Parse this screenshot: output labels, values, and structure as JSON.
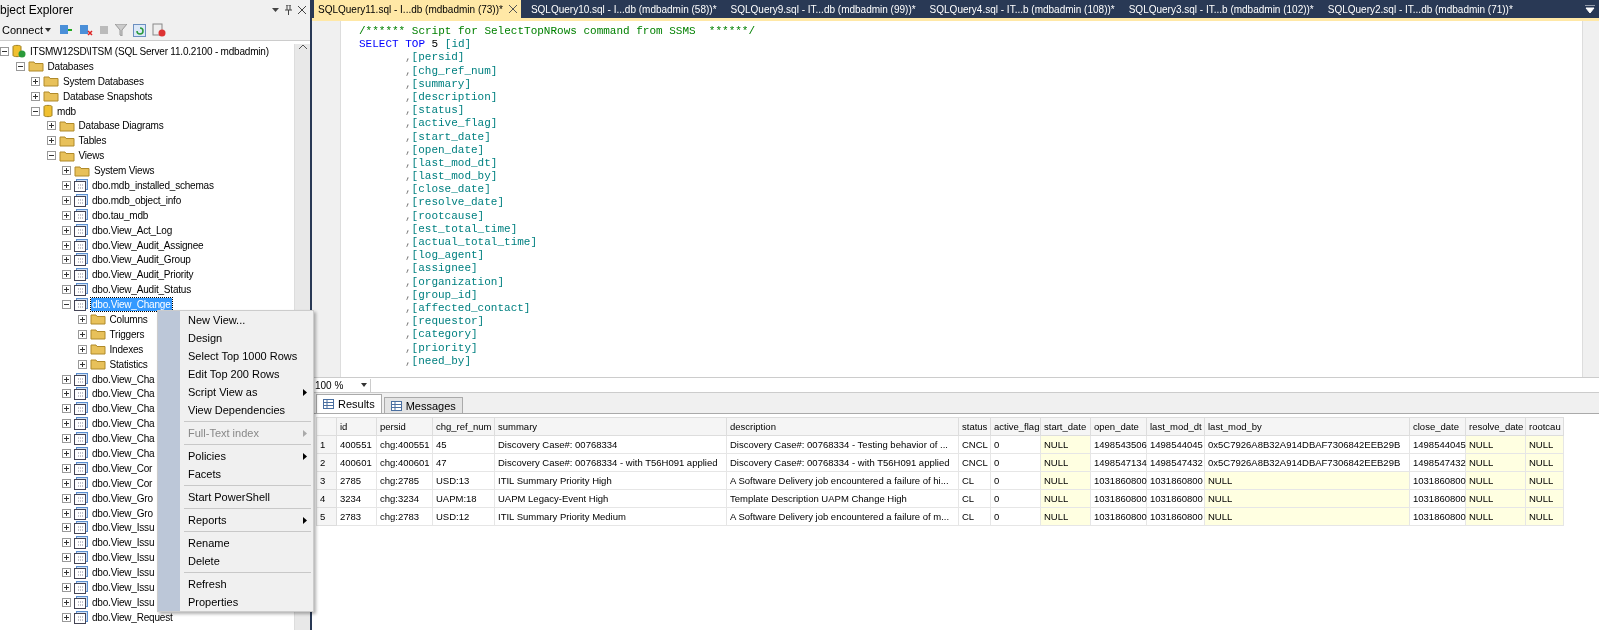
{
  "explorer": {
    "title": "bject Explorer",
    "connect": "Connect",
    "tree": [
      {
        "label": "ITSMW12SD\\ITSM (SQL Server 11.0.2100 - mdbadmin)",
        "kind": "server",
        "expanded": true,
        "selected": false,
        "children": [
          {
            "label": "Databases",
            "kind": "folder",
            "expanded": true,
            "selected": false,
            "children": [
              {
                "label": "System Databases",
                "kind": "folder",
                "expanded": false,
                "selected": false
              },
              {
                "label": "Database Snapshots",
                "kind": "folder",
                "expanded": false,
                "selected": false
              },
              {
                "label": "mdb",
                "kind": "database",
                "expanded": true,
                "selected": false,
                "children": [
                  {
                    "label": "Database Diagrams",
                    "kind": "folder",
                    "expanded": false,
                    "selected": false
                  },
                  {
                    "label": "Tables",
                    "kind": "folder",
                    "expanded": false,
                    "selected": false
                  },
                  {
                    "label": "Views",
                    "kind": "folder",
                    "expanded": true,
                    "selected": false,
                    "children": [
                      {
                        "label": "System Views",
                        "kind": "folder",
                        "expanded": false,
                        "selected": false
                      },
                      {
                        "label": "dbo.mdb_installed_schemas",
                        "kind": "view",
                        "expanded": false,
                        "selected": false
                      },
                      {
                        "label": "dbo.mdb_object_info",
                        "kind": "view",
                        "expanded": false,
                        "selected": false
                      },
                      {
                        "label": "dbo.tau_mdb",
                        "kind": "view",
                        "expanded": false,
                        "selected": false
                      },
                      {
                        "label": "dbo.View_Act_Log",
                        "kind": "view",
                        "expanded": false,
                        "selected": false
                      },
                      {
                        "label": "dbo.View_Audit_Assignee",
                        "kind": "view",
                        "expanded": false,
                        "selected": false
                      },
                      {
                        "label": "dbo.View_Audit_Group",
                        "kind": "view",
                        "expanded": false,
                        "selected": false
                      },
                      {
                        "label": "dbo.View_Audit_Priority",
                        "kind": "view",
                        "expanded": false,
                        "selected": false
                      },
                      {
                        "label": "dbo.View_Audit_Status",
                        "kind": "view",
                        "expanded": false,
                        "selected": false
                      },
                      {
                        "label": "dbo.View_Change",
                        "kind": "view",
                        "expanded": true,
                        "selected": true,
                        "children": [
                          {
                            "label": "Columns",
                            "kind": "folder",
                            "expanded": false,
                            "selected": false
                          },
                          {
                            "label": "Triggers",
                            "kind": "folder",
                            "expanded": false,
                            "selected": false
                          },
                          {
                            "label": "Indexes",
                            "kind": "folder",
                            "expanded": false,
                            "selected": false
                          },
                          {
                            "label": "Statistics",
                            "kind": "folder",
                            "expanded": false,
                            "selected": false
                          }
                        ]
                      },
                      {
                        "label": "dbo.View_Cha",
                        "kind": "view",
                        "expanded": false,
                        "selected": false
                      },
                      {
                        "label": "dbo.View_Cha",
                        "kind": "view",
                        "expanded": false,
                        "selected": false
                      },
                      {
                        "label": "dbo.View_Cha",
                        "kind": "view",
                        "expanded": false,
                        "selected": false
                      },
                      {
                        "label": "dbo.View_Cha",
                        "kind": "view",
                        "expanded": false,
                        "selected": false
                      },
                      {
                        "label": "dbo.View_Cha",
                        "kind": "view",
                        "expanded": false,
                        "selected": false
                      },
                      {
                        "label": "dbo.View_Cha",
                        "kind": "view",
                        "expanded": false,
                        "selected": false
                      },
                      {
                        "label": "dbo.View_Cor",
                        "kind": "view",
                        "expanded": false,
                        "selected": false
                      },
                      {
                        "label": "dbo.View_Cor",
                        "kind": "view",
                        "expanded": false,
                        "selected": false
                      },
                      {
                        "label": "dbo.View_Gro",
                        "kind": "view",
                        "expanded": false,
                        "selected": false
                      },
                      {
                        "label": "dbo.View_Gro",
                        "kind": "view",
                        "expanded": false,
                        "selected": false
                      },
                      {
                        "label": "dbo.View_Issu",
                        "kind": "view",
                        "expanded": false,
                        "selected": false
                      },
                      {
                        "label": "dbo.View_Issu",
                        "kind": "view",
                        "expanded": false,
                        "selected": false
                      },
                      {
                        "label": "dbo.View_Issu",
                        "kind": "view",
                        "expanded": false,
                        "selected": false
                      },
                      {
                        "label": "dbo.View_Issu",
                        "kind": "view",
                        "expanded": false,
                        "selected": false
                      },
                      {
                        "label": "dbo.View_Issu",
                        "kind": "view",
                        "expanded": false,
                        "selected": false
                      },
                      {
                        "label": "dbo.View_Issu",
                        "kind": "view",
                        "expanded": false,
                        "selected": false
                      },
                      {
                        "label": "dbo.View_Request",
                        "kind": "view",
                        "expanded": false,
                        "selected": false
                      }
                    ]
                  }
                ]
              }
            ]
          }
        ]
      }
    ]
  },
  "context_menu": [
    {
      "label": "New View...",
      "separator_before": false,
      "disabled": false,
      "submenu": false
    },
    {
      "label": "Design",
      "separator_before": false,
      "disabled": false,
      "submenu": false
    },
    {
      "label": "Select Top 1000 Rows",
      "separator_before": false,
      "disabled": false,
      "submenu": false
    },
    {
      "label": "Edit Top 200 Rows",
      "separator_before": false,
      "disabled": false,
      "submenu": false
    },
    {
      "label": "Script View as",
      "separator_before": false,
      "disabled": false,
      "submenu": true
    },
    {
      "label": "View Dependencies",
      "separator_before": false,
      "disabled": false,
      "submenu": false
    },
    {
      "label": "Full-Text index",
      "separator_before": true,
      "disabled": true,
      "submenu": true
    },
    {
      "label": "Policies",
      "separator_before": true,
      "disabled": false,
      "submenu": true
    },
    {
      "label": "Facets",
      "separator_before": false,
      "disabled": false,
      "submenu": false
    },
    {
      "label": "Start PowerShell",
      "separator_before": true,
      "disabled": false,
      "submenu": false
    },
    {
      "label": "Reports",
      "separator_before": true,
      "disabled": false,
      "submenu": true
    },
    {
      "label": "Rename",
      "separator_before": true,
      "disabled": false,
      "submenu": false
    },
    {
      "label": "Delete",
      "separator_before": false,
      "disabled": false,
      "submenu": false
    },
    {
      "label": "Refresh",
      "separator_before": true,
      "disabled": false,
      "submenu": false
    },
    {
      "label": "Properties",
      "separator_before": false,
      "disabled": false,
      "submenu": false
    }
  ],
  "tabs": [
    {
      "label": "SQLQuery11.sql - I...db (mdbadmin (73))*",
      "selected": true
    },
    {
      "label": "SQLQuery10.sql - I...db (mdbadmin (58))*",
      "selected": false
    },
    {
      "label": "SQLQuery9.sql - IT...db (mdbadmin (99))*",
      "selected": false
    },
    {
      "label": "SQLQuery4.sql - IT...b (mdbadmin (108))*",
      "selected": false
    },
    {
      "label": "SQLQuery3.sql - IT...b (mdbadmin (102))*",
      "selected": false
    },
    {
      "label": "SQLQuery2.sql - IT...db (mdbadmin (71))*",
      "selected": false
    }
  ],
  "editor": {
    "lines": [
      {
        "kind": "comment",
        "text": "/****** Script for SelectTopNRows command from SSMS  ******/"
      },
      {
        "kind": "select",
        "keyword": "SELECT TOP",
        "number": "5",
        "name": "[id]"
      },
      {
        "kind": "column",
        "name": "[persid]"
      },
      {
        "kind": "column",
        "name": "[chg_ref_num]"
      },
      {
        "kind": "column",
        "name": "[summary]"
      },
      {
        "kind": "column",
        "name": "[description]"
      },
      {
        "kind": "column",
        "name": "[status]"
      },
      {
        "kind": "column",
        "name": "[active_flag]"
      },
      {
        "kind": "column",
        "name": "[start_date]"
      },
      {
        "kind": "column",
        "name": "[open_date]"
      },
      {
        "kind": "column",
        "name": "[last_mod_dt]"
      },
      {
        "kind": "column",
        "name": "[last_mod_by]"
      },
      {
        "kind": "column",
        "name": "[close_date]"
      },
      {
        "kind": "column",
        "name": "[resolve_date]"
      },
      {
        "kind": "column",
        "name": "[rootcause]"
      },
      {
        "kind": "column",
        "name": "[est_total_time]"
      },
      {
        "kind": "column",
        "name": "[actual_total_time]"
      },
      {
        "kind": "column",
        "name": "[log_agent]"
      },
      {
        "kind": "column",
        "name": "[assignee]"
      },
      {
        "kind": "column",
        "name": "[organization]"
      },
      {
        "kind": "column",
        "name": "[group_id]"
      },
      {
        "kind": "column",
        "name": "[affected_contact]"
      },
      {
        "kind": "column",
        "name": "[requestor]"
      },
      {
        "kind": "column",
        "name": "[category]"
      },
      {
        "kind": "column",
        "name": "[priority]"
      },
      {
        "kind": "column",
        "name": "[need_by]"
      }
    ],
    "comma": ",",
    "zoom": "100 %"
  },
  "result_tabs": [
    {
      "label": "Results",
      "selected": true
    },
    {
      "label": "Messages",
      "selected": false
    }
  ],
  "grid": {
    "columns": [
      "id",
      "persid",
      "chg_ref_num",
      "summary",
      "description",
      "status",
      "active_flag",
      "start_date",
      "open_date",
      "last_mod_dt",
      "last_mod_by",
      "close_date",
      "resolve_date",
      "rootcau"
    ],
    "rows": [
      {
        "num": "1",
        "cells": [
          "400551",
          "chg:400551",
          "45",
          "Discovery Case#: 00768334",
          "Discovery Case#: 00768334 - Testing behavior of ...",
          "CNCL",
          "0",
          {
            "v": "NULL",
            "null": true
          },
          "1498543506",
          "1498544045",
          "0x5C7926A8B32A914DBAF7306842EEB29B",
          "1498544045",
          {
            "v": "NULL",
            "null": true
          },
          {
            "v": "NULL",
            "null": true
          }
        ]
      },
      {
        "num": "2",
        "cells": [
          "400601",
          "chg:400601",
          "47",
          "Discovery Case#: 00768334 - with T56H091 applied",
          "Discovery Case#: 00768334 - with T56H091 applied",
          "CNCL",
          "0",
          {
            "v": "NULL",
            "null": true
          },
          "1498547134",
          "1498547432",
          "0x5C7926A8B32A914DBAF7306842EEB29B",
          "1498547432",
          {
            "v": "NULL",
            "null": true
          },
          {
            "v": "NULL",
            "null": true
          }
        ]
      },
      {
        "num": "3",
        "cells": [
          "2785",
          "chg:2785",
          "USD:13",
          "ITIL Summary Priority High",
          "A Software Delivery job encountered a failure of hi...",
          "CL",
          "0",
          {
            "v": "NULL",
            "null": true
          },
          "1031860800",
          "1031860800",
          {
            "v": "NULL",
            "null": true
          },
          "1031860800",
          {
            "v": "NULL",
            "null": true
          },
          {
            "v": "NULL",
            "null": true
          }
        ]
      },
      {
        "num": "4",
        "cells": [
          "3234",
          "chg:3234",
          "UAPM:18",
          "UAPM Legacy-Event High",
          "Template Description UAPM Change High",
          "CL",
          "0",
          {
            "v": "NULL",
            "null": true
          },
          "1031860800",
          "1031860800",
          {
            "v": "NULL",
            "null": true
          },
          "1031860800",
          {
            "v": "NULL",
            "null": true
          },
          {
            "v": "NULL",
            "null": true
          }
        ]
      },
      {
        "num": "5",
        "cells": [
          "2783",
          "chg:2783",
          "USD:12",
          "ITIL Summary Priority Medium",
          "A Software Delivery job encountered a failure of m...",
          "CL",
          "0",
          {
            "v": "NULL",
            "null": true
          },
          "1031860800",
          "1031860800",
          {
            "v": "NULL",
            "null": true
          },
          "1031860800",
          {
            "v": "NULL",
            "null": true
          },
          {
            "v": "NULL",
            "null": true
          }
        ]
      }
    ]
  }
}
